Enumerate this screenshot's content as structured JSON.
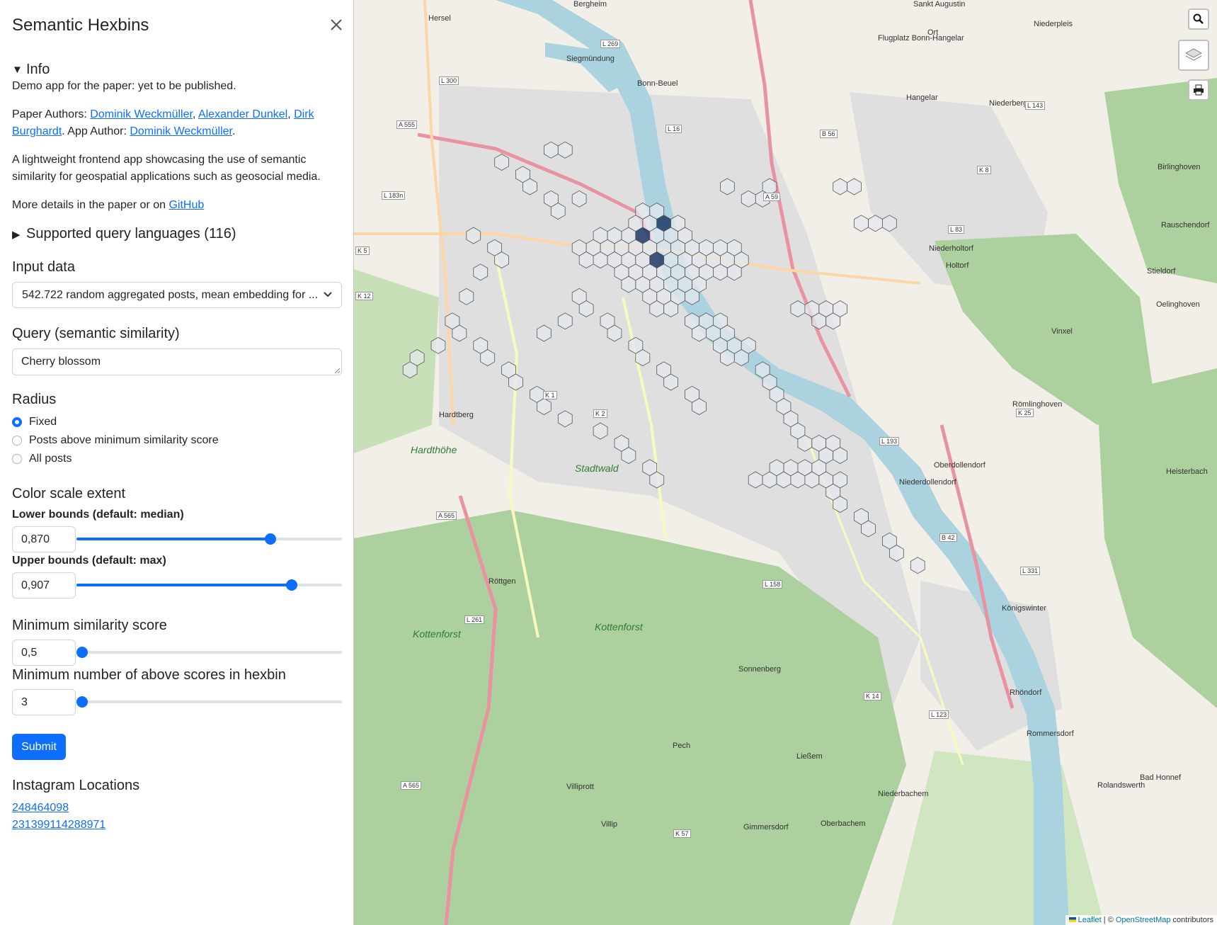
{
  "sidebar": {
    "title": "Semantic Hexbins",
    "info": {
      "summary": "Info",
      "line1": "Demo app for the paper: yet to be published.",
      "authors_prefix": "Paper Authors: ",
      "author1": "Dominik Weckmüller",
      "sep1": ", ",
      "author2": "Alexander Dunkel",
      "sep2": ", ",
      "author3": "Dirk Burghardt",
      "app_author_prefix": ". App Author: ",
      "app_author": "Dominik Weckmüller",
      "period": ".",
      "description": "A lightweight frontend app showcasing the use of semantic similarity for geospatial applications such as geosocial media.",
      "more_prefix": "More details in the paper or on ",
      "github": "GitHub"
    },
    "languages_summary": "Supported query languages (116)",
    "input_label": "Input data",
    "input_value": "542.722 random aggregated posts, mean embedding for ...",
    "query_label": "Query (semantic similarity)",
    "query_value": "Cherry blossom",
    "radius_label": "Radius",
    "radius_options": [
      "Fixed",
      "Posts above minimum similarity score",
      "All posts"
    ],
    "radius_selected": 0,
    "color_scale_label": "Color scale extent",
    "lower_label": "Lower bounds (default: median)",
    "lower_value": "0,870",
    "lower_slider": 0.73,
    "upper_label": "Upper bounds (default: max)",
    "upper_value": "0,907",
    "upper_slider": 0.81,
    "minsim_label": "Minimum similarity score",
    "minsim_value": "0,5",
    "minsim_slider": 0.0,
    "mincount_label": "Minimum number of above scores in hexbin",
    "mincount_value": "3",
    "mincount_slider": 0.0,
    "submit": "Submit",
    "instagram_label": "Instagram Locations",
    "instagram_ids": [
      "248464098",
      "231399114288971"
    ]
  },
  "map": {
    "labels": [
      {
        "t": "Hersel"
      },
      {
        "t": "Bergheim"
      },
      {
        "t": "Sankt Augustin"
      },
      {
        "t": "Niederpleis"
      },
      {
        "t": "Ort"
      },
      {
        "t": "Hangelar"
      },
      {
        "t": "Niederberg"
      },
      {
        "t": "Birlinghoven"
      },
      {
        "t": "Rauschendorf"
      },
      {
        "t": "Niederholtorf"
      },
      {
        "t": "Holtorf"
      },
      {
        "t": "Stieldorf"
      },
      {
        "t": "Oelinghoven"
      },
      {
        "t": "Vinxel"
      },
      {
        "t": "Römlinghoven"
      },
      {
        "t": "Oberdollendorf"
      },
      {
        "t": "Niederdollendorf"
      },
      {
        "t": "Hardtberg"
      },
      {
        "t": "Röttgen"
      },
      {
        "t": "Königswinter"
      },
      {
        "t": "Kottenforst"
      },
      {
        "t": "Kottenforst"
      },
      {
        "t": "Pech"
      },
      {
        "t": "Ließem"
      },
      {
        "t": "Villiprott"
      },
      {
        "t": "Villip"
      },
      {
        "t": "Gimmersdorf"
      },
      {
        "t": "Oberbachem"
      },
      {
        "t": "Niederbachem"
      },
      {
        "t": "Rhöndorf"
      },
      {
        "t": "Rommersdorf"
      },
      {
        "t": "Bad Honnef"
      },
      {
        "t": "Rolandswerth"
      },
      {
        "t": "Hardthöhe"
      },
      {
        "t": "Stadtwald"
      },
      {
        "t": "Sonnenberg"
      },
      {
        "t": "Heisterbach"
      },
      {
        "t": "Bonn-Beuel"
      },
      {
        "t": "Siegmündung"
      },
      {
        "t": "Flugplatz Bonn-Hangelar"
      }
    ],
    "roads": [
      "L 269",
      "L 300",
      "A 555",
      "L 16",
      "B 56",
      "K 8",
      "L 143",
      "L 183n",
      "A 59",
      "L 83",
      "K 5",
      "K 12",
      "K 1",
      "K 2",
      "L 193",
      "K 25",
      "A 565",
      "B 42",
      "L 331",
      "L 158",
      "L 261",
      "K 14",
      "L 123",
      "K 57",
      "A 565"
    ],
    "attribution_leaflet": "Leaflet",
    "attribution_sep": " | © ",
    "attribution_osm": "OpenStreetMap",
    "attribution_tail": " contributors",
    "colors": {
      "hex_dark": "#1f3a68",
      "hex_mid": "#6a7fa3",
      "hex_light": "#e4e8ef",
      "forest": "#add19e",
      "river": "#aad3df",
      "urban": "#e0dfdf",
      "motorway": "#e892a2",
      "primary": "#fcd6a4"
    },
    "hexbins": [
      [
        27,
        8,
        1
      ],
      [
        28,
        8,
        1
      ],
      [
        27,
        9,
        1
      ],
      [
        28,
        9,
        2
      ],
      [
        26,
        9,
        1
      ],
      [
        29,
        9,
        1
      ],
      [
        26,
        10,
        1
      ],
      [
        27,
        10,
        2
      ],
      [
        28,
        10,
        1
      ],
      [
        29,
        10,
        1
      ],
      [
        30,
        10,
        1
      ],
      [
        25,
        10,
        1
      ],
      [
        24,
        10,
        1
      ],
      [
        25,
        11,
        1
      ],
      [
        26,
        11,
        1
      ],
      [
        27,
        11,
        1
      ],
      [
        28,
        11,
        1
      ],
      [
        29,
        11,
        1
      ],
      [
        30,
        11,
        1
      ],
      [
        31,
        11,
        1
      ],
      [
        24,
        11,
        1
      ],
      [
        23,
        11,
        1
      ],
      [
        22,
        11,
        1
      ],
      [
        32,
        11,
        1
      ],
      [
        33,
        11,
        1
      ],
      [
        25,
        12,
        1
      ],
      [
        26,
        12,
        1
      ],
      [
        27,
        12,
        1
      ],
      [
        28,
        12,
        2
      ],
      [
        29,
        12,
        1
      ],
      [
        30,
        12,
        1
      ],
      [
        31,
        12,
        1
      ],
      [
        32,
        12,
        1
      ],
      [
        24,
        12,
        1
      ],
      [
        23,
        12,
        1
      ],
      [
        33,
        12,
        1
      ],
      [
        34,
        12,
        1
      ],
      [
        26,
        13,
        1
      ],
      [
        27,
        13,
        1
      ],
      [
        28,
        13,
        1
      ],
      [
        29,
        13,
        1
      ],
      [
        30,
        13,
        1
      ],
      [
        31,
        13,
        1
      ],
      [
        25,
        13,
        1
      ],
      [
        32,
        13,
        1
      ],
      [
        33,
        13,
        1
      ],
      [
        27,
        14,
        1
      ],
      [
        28,
        14,
        1
      ],
      [
        29,
        14,
        1
      ],
      [
        30,
        14,
        1
      ],
      [
        26,
        14,
        1
      ],
      [
        31,
        14,
        1
      ],
      [
        28,
        15,
        1
      ],
      [
        29,
        15,
        1
      ],
      [
        27,
        15,
        1
      ],
      [
        30,
        15,
        1
      ],
      [
        28,
        16,
        1
      ],
      [
        29,
        16,
        1
      ],
      [
        30,
        17,
        1
      ],
      [
        31,
        17,
        1
      ],
      [
        32,
        17,
        1
      ],
      [
        31,
        18,
        1
      ],
      [
        32,
        18,
        1
      ],
      [
        33,
        18,
        1
      ],
      [
        32,
        19,
        1
      ],
      [
        33,
        19,
        1
      ],
      [
        34,
        19,
        1
      ],
      [
        33,
        20,
        1
      ],
      [
        34,
        20,
        1
      ],
      [
        35,
        21,
        1
      ],
      [
        36,
        22,
        1
      ],
      [
        36,
        23,
        1
      ],
      [
        37,
        24,
        1
      ],
      [
        37,
        25,
        1
      ],
      [
        38,
        26,
        1
      ],
      [
        38,
        27,
        1
      ],
      [
        39,
        27,
        1
      ],
      [
        40,
        27,
        1
      ],
      [
        40,
        28,
        1
      ],
      [
        41,
        28,
        1
      ],
      [
        39,
        17,
        1
      ],
      [
        40,
        17,
        1
      ],
      [
        38,
        16,
        1
      ],
      [
        39,
        16,
        1
      ],
      [
        40,
        16,
        1
      ],
      [
        41,
        16,
        1
      ],
      [
        42,
        9,
        1
      ],
      [
        43,
        9,
        1
      ],
      [
        44,
        9,
        1
      ],
      [
        41,
        6,
        1
      ],
      [
        42,
        6,
        1
      ],
      [
        36,
        6,
        1
      ],
      [
        35,
        7,
        1
      ],
      [
        33,
        6,
        1
      ],
      [
        34,
        7,
        1
      ],
      [
        20,
        3,
        1
      ],
      [
        21,
        3,
        1
      ],
      [
        17,
        4,
        1
      ],
      [
        18,
        5,
        1
      ],
      [
        19,
        6,
        1
      ],
      [
        20,
        7,
        1
      ],
      [
        21,
        8,
        1
      ],
      [
        22,
        7,
        1
      ],
      [
        15,
        10,
        1
      ],
      [
        16,
        11,
        1
      ],
      [
        17,
        12,
        1
      ],
      [
        15,
        13,
        1
      ],
      [
        14,
        15,
        1
      ],
      [
        13,
        17,
        1
      ],
      [
        14,
        18,
        1
      ],
      [
        15,
        19,
        1
      ],
      [
        16,
        20,
        1
      ],
      [
        17,
        21,
        1
      ],
      [
        18,
        22,
        1
      ],
      [
        19,
        23,
        1
      ],
      [
        20,
        24,
        1
      ],
      [
        21,
        25,
        1
      ],
      [
        12,
        19,
        1
      ],
      [
        11,
        20,
        1
      ],
      [
        10,
        21,
        1
      ],
      [
        22,
        15,
        1
      ],
      [
        23,
        16,
        1
      ],
      [
        24,
        17,
        1
      ],
      [
        21,
        17,
        1
      ],
      [
        20,
        18,
        1
      ],
      [
        25,
        18,
        1
      ],
      [
        26,
        19,
        1
      ],
      [
        27,
        20,
        1
      ],
      [
        28,
        21,
        1
      ],
      [
        29,
        22,
        1
      ],
      [
        30,
        23,
        1
      ],
      [
        31,
        24,
        1
      ],
      [
        24,
        26,
        1
      ],
      [
        25,
        27,
        1
      ],
      [
        26,
        28,
        1
      ],
      [
        27,
        29,
        1
      ],
      [
        28,
        30,
        1
      ],
      [
        35,
        30,
        1
      ],
      [
        36,
        30,
        1
      ],
      [
        37,
        30,
        1
      ],
      [
        38,
        30,
        1
      ],
      [
        39,
        30,
        1
      ],
      [
        40,
        30,
        1
      ],
      [
        41,
        30,
        1
      ],
      [
        36,
        29,
        1
      ],
      [
        37,
        29,
        1
      ],
      [
        38,
        29,
        1
      ],
      [
        39,
        29,
        1
      ],
      [
        40,
        31,
        1
      ],
      [
        41,
        32,
        1
      ],
      [
        42,
        33,
        1
      ],
      [
        43,
        34,
        1
      ],
      [
        44,
        35,
        1
      ],
      [
        45,
        36,
        1
      ],
      [
        46,
        37,
        1
      ]
    ]
  }
}
